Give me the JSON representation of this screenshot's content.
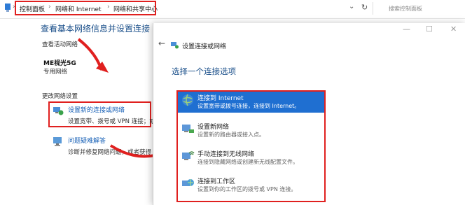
{
  "breadcrumb": {
    "items": [
      "控制面板",
      "网络和 Internet",
      "网络和共享中心"
    ],
    "separator": "›"
  },
  "search": {
    "placeholder": "搜索控制面板"
  },
  "background": {
    "page_title": "查看基本网络信息并设置连接",
    "active_networks_label": "查看活动网络",
    "network_name": "ME视光5G",
    "network_type": "专用网络",
    "change_settings_label": "更改网络设置",
    "setup_link": "设置新的连接或网络",
    "setup_desc": "设置宽带、拨号或 VPN 连接；或",
    "troubleshoot_link": "问题疑难解答",
    "troubleshoot_desc": "诊断并修复网络问题，或者获得"
  },
  "dialog": {
    "back_glyph": "←",
    "title": "设置连接或网络",
    "heading": "选择一个连接选项",
    "controls": {
      "minimize": "—",
      "maximize": "☐",
      "close": "✕"
    },
    "options": [
      {
        "title": "连接到 Internet",
        "desc": "设置宽带或拨号连接，连接到 Internet。",
        "selected": true,
        "icon": "globe-icon"
      },
      {
        "title": "设置新网络",
        "desc": "设置新的路由器或接入点。",
        "selected": false,
        "icon": "router-icon"
      },
      {
        "title": "手动连接到无线网络",
        "desc": "连接到隐藏网络或创建新无线配置文件。",
        "selected": false,
        "icon": "wireless-icon"
      },
      {
        "title": "连接到工作区",
        "desc": "设置到你的工作区的拨号或 VPN 连接。",
        "selected": false,
        "icon": "workplace-icon"
      }
    ]
  },
  "colors": {
    "accent": "#1f6fd1",
    "highlight": "#e0201f",
    "link": "#1a62b7",
    "heading": "#1a4f8a"
  }
}
